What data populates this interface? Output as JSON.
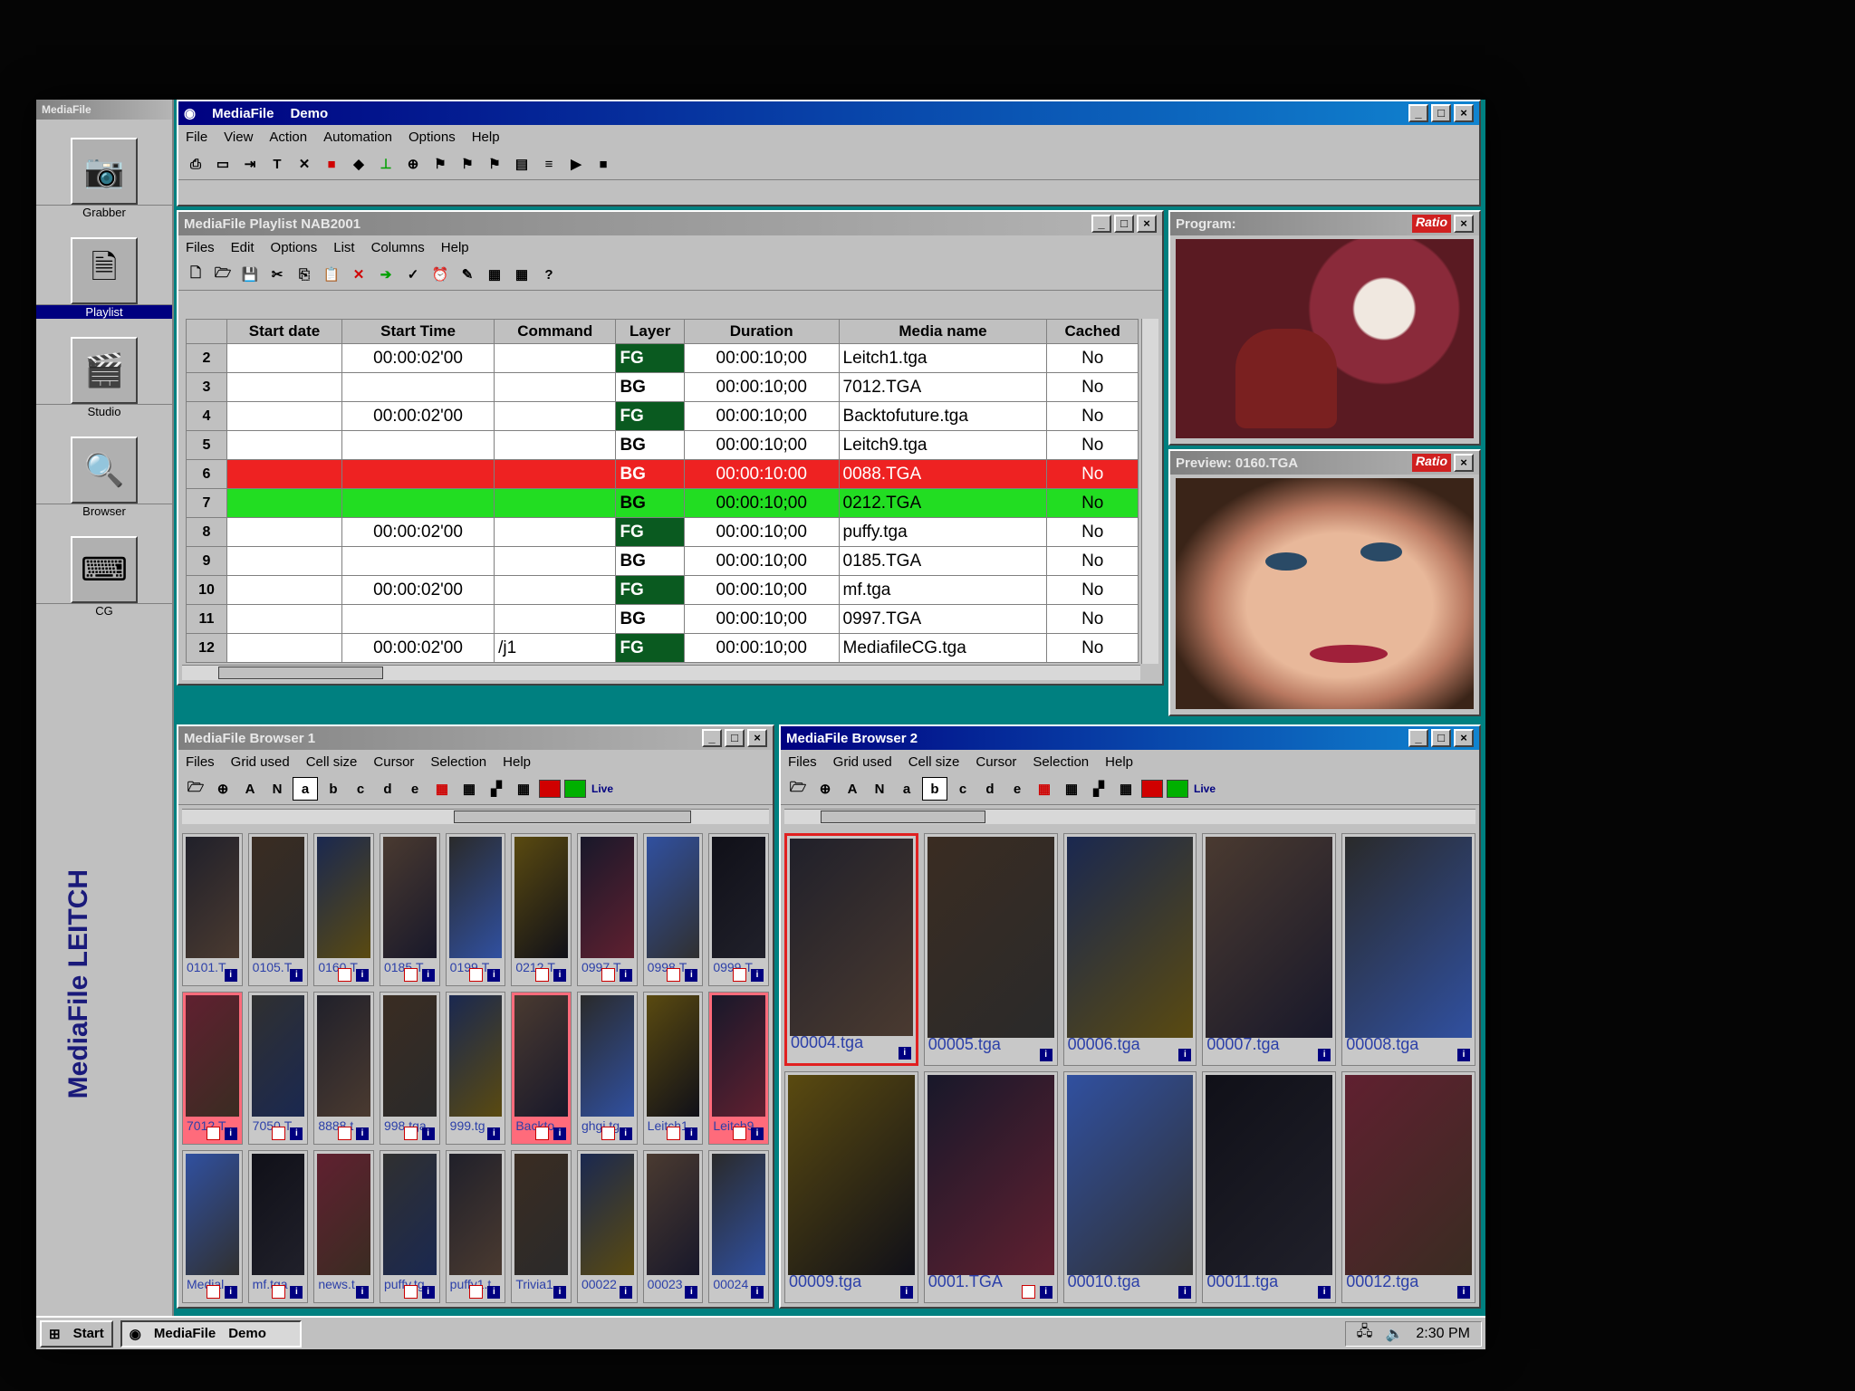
{
  "app": {
    "main_title": "MediaFile",
    "main_subtitle": "Demo"
  },
  "main_menu": [
    "File",
    "View",
    "Action",
    "Automation",
    "Options",
    "Help"
  ],
  "left_bar": {
    "items": [
      {
        "label": "Grabber",
        "icon": "camera-icon"
      },
      {
        "label": "Playlist",
        "icon": "playlist-icon"
      },
      {
        "label": "Studio",
        "icon": "clapper-icon"
      },
      {
        "label": "Browser",
        "icon": "magnifier-icon"
      },
      {
        "label": "CG",
        "icon": "typewriter-icon"
      }
    ],
    "brand": "MediaFile LEITCH"
  },
  "playlist": {
    "title": "MediaFile  Playlist  NAB2001",
    "menu": [
      "Files",
      "Edit",
      "Options",
      "List",
      "Columns",
      "Help"
    ],
    "columns": [
      "Start date",
      "Start Time",
      "Command",
      "Layer",
      "Duration",
      "Media name",
      "Cached"
    ],
    "rows": [
      {
        "n": "2",
        "date": "",
        "time": "00:00:02'00",
        "cmd": "",
        "layer": "FG",
        "dur": "00:00:10;00",
        "media": "Leitch1.tga",
        "cached": "No",
        "state": ""
      },
      {
        "n": "3",
        "date": "",
        "time": "",
        "cmd": "",
        "layer": "BG",
        "dur": "00:00:10;00",
        "media": "7012.TGA",
        "cached": "No",
        "state": ""
      },
      {
        "n": "4",
        "date": "",
        "time": "00:00:02'00",
        "cmd": "",
        "layer": "FG",
        "dur": "00:00:10;00",
        "media": "Backtofuture.tga",
        "cached": "No",
        "state": ""
      },
      {
        "n": "5",
        "date": "",
        "time": "",
        "cmd": "",
        "layer": "BG",
        "dur": "00:00:10;00",
        "media": "Leitch9.tga",
        "cached": "No",
        "state": ""
      },
      {
        "n": "6",
        "date": "",
        "time": "",
        "cmd": "",
        "layer": "BG",
        "dur": "00:00:10:00",
        "media": "0088.TGA",
        "cached": "No",
        "state": "red"
      },
      {
        "n": "7",
        "date": "",
        "time": "",
        "cmd": "",
        "layer": "BG",
        "dur": "00:00:10;00",
        "media": "0212.TGA",
        "cached": "No",
        "state": "green"
      },
      {
        "n": "8",
        "date": "",
        "time": "00:00:02'00",
        "cmd": "",
        "layer": "FG",
        "dur": "00:00:10;00",
        "media": "puffy.tga",
        "cached": "No",
        "state": ""
      },
      {
        "n": "9",
        "date": "",
        "time": "",
        "cmd": "",
        "layer": "BG",
        "dur": "00:00:10;00",
        "media": "0185.TGA",
        "cached": "No",
        "state": ""
      },
      {
        "n": "10",
        "date": "",
        "time": "00:00:02'00",
        "cmd": "",
        "layer": "FG",
        "dur": "00:00:10;00",
        "media": "mf.tga",
        "cached": "No",
        "state": ""
      },
      {
        "n": "11",
        "date": "",
        "time": "",
        "cmd": "",
        "layer": "BG",
        "dur": "00:00:10;00",
        "media": "0997.TGA",
        "cached": "No",
        "state": ""
      },
      {
        "n": "12",
        "date": "",
        "time": "00:00:02'00",
        "cmd": "/j1",
        "layer": "FG",
        "dur": "00:00:10;00",
        "media": "MediafileCG.tga",
        "cached": "No",
        "state": ""
      }
    ]
  },
  "program": {
    "title": "Program:",
    "ratio": "Ratio"
  },
  "preview": {
    "title": "Preview:  0160.TGA",
    "ratio": "Ratio"
  },
  "browser1": {
    "title": "MediaFile  Browser 1",
    "menu": [
      "Files",
      "Grid used",
      "Cell size",
      "Cursor",
      "Selection",
      "Help"
    ],
    "letters": [
      "a",
      "b",
      "c",
      "d",
      "e"
    ],
    "live": "Live",
    "thumbs": [
      "0101.T",
      "0105.T",
      "0160.T",
      "0185.T",
      "0199.T",
      "0212.T",
      "0997.T",
      "0998.T",
      "0999.T",
      "7012.T",
      "7050.T",
      "8888.t",
      "998.tga",
      "999.tg",
      "Backto",
      "ghgj.tg",
      "Leitch1",
      "Leitch9",
      "Medial",
      "mf.tga",
      "news.t",
      "puffy.tg",
      "puffy1.t",
      "Trivia1",
      "00022",
      "00023",
      "00024"
    ]
  },
  "browser2": {
    "title": "MediaFile  Browser 2",
    "menu": [
      "Files",
      "Grid used",
      "Cell size",
      "Cursor",
      "Selection",
      "Help"
    ],
    "letters": [
      "a",
      "b",
      "c",
      "d",
      "e"
    ],
    "live": "Live",
    "thumbs": [
      "00004.tga",
      "00005.tga",
      "00006.tga",
      "00007.tga",
      "00008.tga",
      "00009.tga",
      "0001.TGA",
      "00010.tga",
      "00011.tga",
      "00012.tga"
    ]
  },
  "taskbar": {
    "start": "Start",
    "task_app": "MediaFile",
    "task_doc": "Demo",
    "clock": "2:30 PM"
  },
  "colors": {
    "titlebar": "#000080",
    "playing": "#ee2222",
    "cued": "#22dd22",
    "fg_layer": "#0a5a20",
    "thumb_label": "#2b3fa8"
  }
}
